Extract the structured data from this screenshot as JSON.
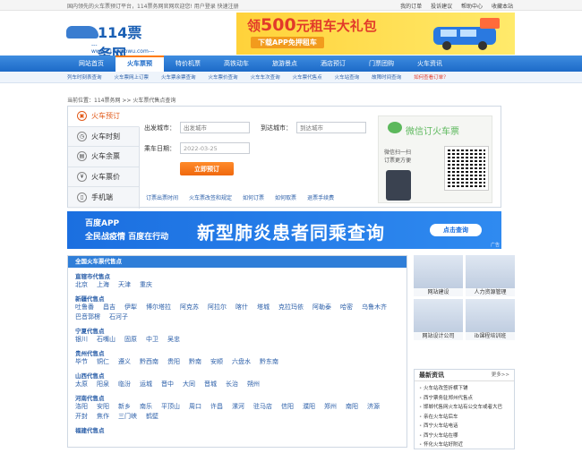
{
  "topbar": {
    "tagline": "国内领先的火车票预订平台，114票务网官网欢迎您!  用户登录    快速注册",
    "links": [
      "我的订单",
      "投诉建议",
      "帮助中心",
      "收藏本站"
    ]
  },
  "logo": {
    "name": "114票务网",
    "url": "---www.114piaowu.com---"
  },
  "banner": {
    "headline_pre": "领",
    "headline_num": "500",
    "headline_post": "元租车大礼包",
    "cta": "下载APP免押租车"
  },
  "nav": [
    "网站首页",
    "火车票预订",
    "特价机票",
    "高铁动车",
    "旅游景点",
    "酒店预订",
    "门票团购",
    "火车资讯"
  ],
  "subnav": [
    "列车时刻表查询",
    "火车票网上订票",
    "火车票余票查询",
    "火车票价查询",
    "火车车次查询",
    "火车票代售点",
    "火车站查询",
    "故障时间查询",
    "如何查看订单？"
  ],
  "crumb": "当前位置：114票务网 >> 火车票代售点查询",
  "tabs": [
    "火车预订",
    "火车时刻",
    "火车余票",
    "火车票价",
    "手机端"
  ],
  "form": {
    "from_label": "出发城市：",
    "from_placeholder": "出发城市",
    "to_label": "到达城市：",
    "to_placeholder": "到达城市",
    "date_label": "乘车日期：",
    "date_value": "2022-03-25",
    "book_button": "立即预订"
  },
  "help_links": [
    "订票出票时间",
    "火车票改签和规定",
    "如何订票",
    "如何取票",
    "退票手续费"
  ],
  "wechat": {
    "title": "微信订火车票",
    "sub1": "微信扫一扫",
    "sub2": "订票更方便"
  },
  "ad": {
    "app": "百度APP",
    "slogan": "全民战疫情 百度在行动",
    "headline": "新型肺炎患者同乘查询",
    "button": "点击查询",
    "tag": "广告"
  },
  "main": {
    "header": "全国火车票代售点",
    "sections": [
      {
        "title": "直辖市代售点",
        "cities": [
          "北京",
          "上海",
          "天津",
          "重庆"
        ]
      },
      {
        "title": "新疆代售点",
        "cities": [
          "吐鲁番",
          "昌吉",
          "伊犁",
          "博尔塔拉",
          "阿克苏",
          "阿拉尔",
          "喀什",
          "塔城",
          "克拉玛依",
          "阿勒泰",
          "哈密",
          "乌鲁木齐",
          "巴音郭楞",
          "石河子"
        ]
      },
      {
        "title": "宁夏代售点",
        "cities": [
          "银川",
          "石嘴山",
          "固原",
          "中卫",
          "吴忠"
        ]
      },
      {
        "title": "贵州代售点",
        "cities": [
          "毕节",
          "铜仁",
          "遵义",
          "黔西南",
          "贵阳",
          "黔南",
          "安顺",
          "六盘水",
          "黔东南"
        ]
      },
      {
        "title": "山西代售点",
        "cities": [
          "太原",
          "阳泉",
          "临汾",
          "运城",
          "晋中",
          "大同",
          "晋城",
          "长治",
          "朔州"
        ]
      },
      {
        "title": "河南代售点",
        "cities": [
          "洛阳",
          "安阳",
          "新乡",
          "南乐",
          "平顶山",
          "周口",
          "许昌",
          "漯河",
          "驻马店",
          "信阳",
          "濮阳",
          "郑州",
          "南阳",
          "济源",
          "开封",
          "焦作",
          "三门峡",
          "鹤壁"
        ]
      },
      {
        "title": "福建代售点",
        "cities": []
      }
    ]
  },
  "side": {
    "pics": [
      "网站建设",
      "人力资源管理",
      "网站设计公司",
      "ib课程培训班"
    ],
    "news_title": "最新资讯",
    "news_more": "更多>>",
    "news": [
      "火车站改签折横下铺",
      "西宁票务驻郑州代售点",
      "邯郸代售网火车站有公交车或者大巴",
      "亲在火车站后车",
      "西宁火车站电话",
      "西宁火车站在哪",
      "怀化火车站好附近"
    ]
  }
}
